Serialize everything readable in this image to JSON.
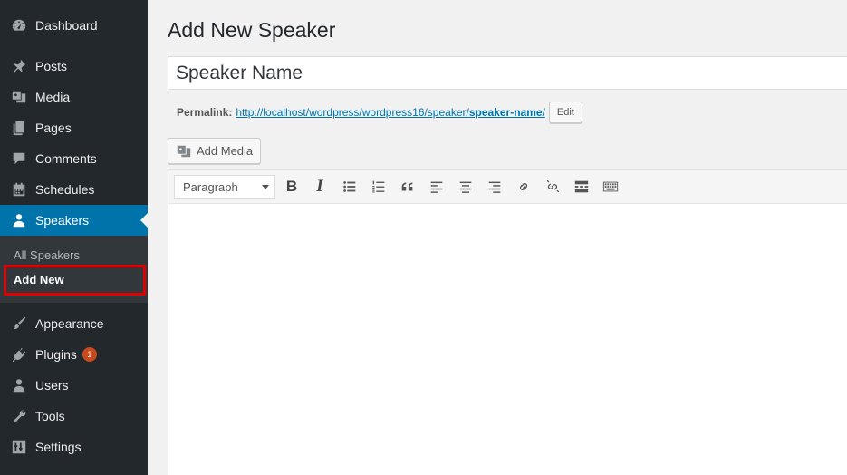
{
  "sidebar": {
    "items": [
      {
        "label": "Dashboard",
        "icon": "dashboard-icon"
      },
      {
        "label": "Posts",
        "icon": "pin-icon"
      },
      {
        "label": "Media",
        "icon": "media-icon"
      },
      {
        "label": "Pages",
        "icon": "pages-icon"
      },
      {
        "label": "Comments",
        "icon": "comment-icon"
      },
      {
        "label": "Schedules",
        "icon": "calendar-icon"
      },
      {
        "label": "Speakers",
        "icon": "user-icon"
      },
      {
        "label": "Appearance",
        "icon": "brush-icon"
      },
      {
        "label": "Plugins",
        "icon": "plugin-icon",
        "badge": "1"
      },
      {
        "label": "Users",
        "icon": "users-icon"
      },
      {
        "label": "Tools",
        "icon": "wrench-icon"
      },
      {
        "label": "Settings",
        "icon": "settings-icon"
      }
    ],
    "submenu": {
      "all_speakers": "All Speakers",
      "add_new": "Add New"
    },
    "colors": {
      "background": "#23282d",
      "active": "#0073aa",
      "highlight": "#e00000"
    }
  },
  "main": {
    "title": "Add New Speaker",
    "title_input_value": "Speaker Name",
    "permalink_label": "Permalink:",
    "permalink_base": "http://localhost/wordpress/wordpress16/speaker/",
    "permalink_slug": "speaker-name",
    "permalink_trailing": "/",
    "edit_button": "Edit",
    "add_media_button": "Add Media"
  },
  "editor": {
    "format_select": "Paragraph",
    "toolbar": {
      "bold": "B",
      "italic": "I"
    }
  }
}
